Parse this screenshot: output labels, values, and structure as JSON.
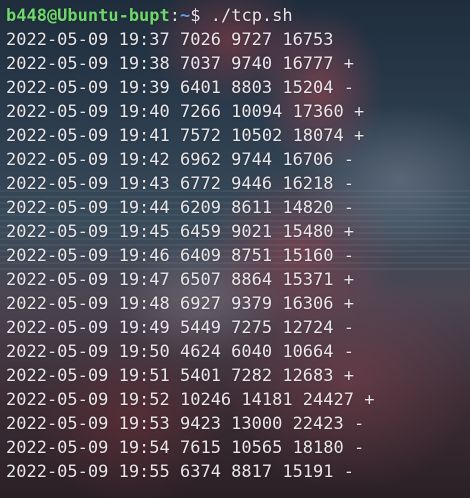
{
  "terminal": {
    "prompt": {
      "user_host": "b448@Ubuntu-bupt",
      "separator": ":",
      "path": "~",
      "symbol": "$ ",
      "command": "./tcp.sh"
    },
    "output_lines": [
      "2022-05-09 19:37 7026 9727 16753",
      "2022-05-09 19:38 7037 9740 16777 +",
      "2022-05-09 19:39 6401 8803 15204 -",
      "2022-05-09 19:40 7266 10094 17360 +",
      "2022-05-09 19:41 7572 10502 18074 +",
      "2022-05-09 19:42 6962 9744 16706 -",
      "2022-05-09 19:43 6772 9446 16218 -",
      "2022-05-09 19:44 6209 8611 14820 -",
      "2022-05-09 19:45 6459 9021 15480 +",
      "2022-05-09 19:46 6409 8751 15160 -",
      "2022-05-09 19:47 6507 8864 15371 +",
      "2022-05-09 19:48 6927 9379 16306 +",
      "2022-05-09 19:49 5449 7275 12724 -",
      "2022-05-09 19:50 4624 6040 10664 -",
      "2022-05-09 19:51 5401 7282 12683 +",
      "2022-05-09 19:52 10246 14181 24427 +",
      "2022-05-09 19:53 9423 13000 22423 -",
      "2022-05-09 19:54 7615 10565 18180 -",
      "2022-05-09 19:55 6374 8817 15191 -"
    ],
    "colors": {
      "prompt_user": "#6fd86a",
      "prompt_path": "#6c9bf0",
      "text": "#e9e6ea"
    }
  }
}
